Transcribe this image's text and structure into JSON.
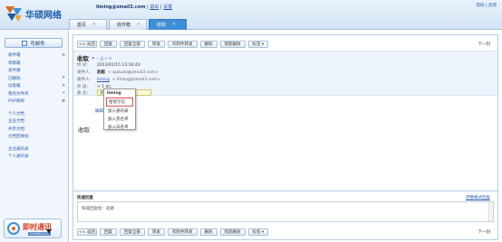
{
  "header": {
    "logo_text": "华硕网络",
    "user_email": "liming@zmail3.com",
    "logout": "退出",
    "settings": "设置",
    "top_links": [
      "帮助",
      "反馈"
    ],
    "tabs": [
      {
        "label": "首页",
        "close": "✕",
        "active": false
      },
      {
        "label": "收件箱",
        "close": "✕",
        "active": false
      },
      {
        "label": "收取",
        "close": "✕",
        "active": true
      }
    ]
  },
  "sidebar": {
    "compose": "写邮件",
    "folders": [
      {
        "label": "收件箱",
        "ctl": "⟳"
      },
      {
        "label": "草稿箱",
        "ctl": ""
      },
      {
        "label": "发件箱",
        "ctl": ""
      },
      {
        "label": "已删除",
        "ctl": "✕"
      },
      {
        "label": "垃圾箱",
        "ctl": "✕"
      },
      {
        "label": "我的文件夹",
        "ctl": "+"
      },
      {
        "label": "POP收邮",
        "ctl": "⚙"
      }
    ],
    "docs": [
      "个人文档",
      "企业文档",
      "共享文档",
      "文档回收站"
    ],
    "contacts": [
      "企业通讯录",
      "个人通讯录"
    ],
    "im_title": "即时通讯",
    "im_sub": "DOWNLOAD"
  },
  "toolbar": {
    "back": "<< 返回",
    "buttons": [
      "回复",
      "回复全部",
      "转发",
      "作附件转发",
      "删除",
      "彻底删除"
    ],
    "tag": "标签 ▾",
    "next": "下一封"
  },
  "mail": {
    "subject": "收取",
    "flags": "⚑ ☆ ⎙ ⚠ ✉",
    "time_label": "时  间：",
    "time": "2013/01/15 13:16:43",
    "from_label": "发件人：",
    "from_name": "赵献",
    "from_addr": "< quzuan@zmail3.com>",
    "to_label": "收件人：",
    "to_name": "liming",
    "to_addr": "< liming@zmail3.com>",
    "cc_label": "抄  送：",
    "cc_value": "< 1                 dc;",
    "bcc_label": "备  注：",
    "bcc_value": "文件",
    "edit_link": "编辑",
    "body": "收取"
  },
  "context_menu": {
    "title": "liming",
    "items": [
      {
        "label": "给他写信",
        "highlight": true
      },
      {
        "label": "加入通讯录",
        "highlight": false
      },
      {
        "label": "加入黑名单",
        "highlight": false
      },
      {
        "label": "加入白名单",
        "highlight": false
      }
    ]
  },
  "quick_reply": {
    "title": "快速回复",
    "mode_link": "完整模式回复",
    "placeholder": "快速回复给：赵献"
  }
}
